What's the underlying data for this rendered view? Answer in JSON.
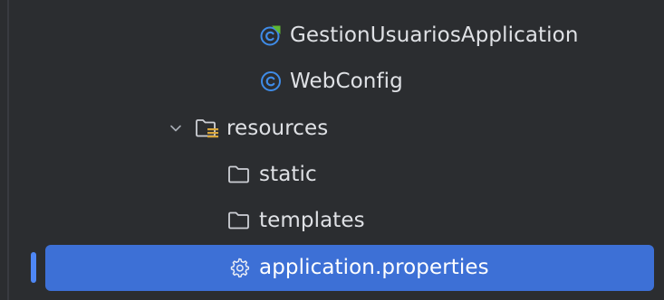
{
  "project_tree": {
    "items": [
      {
        "label": "GestionUsuariosApplication",
        "icon": "spring-boot-class-icon"
      },
      {
        "label": "WebConfig",
        "icon": "class-icon"
      },
      {
        "label": "resources",
        "icon": "resources-folder-icon",
        "expanded": true
      },
      {
        "label": "static",
        "icon": "folder-icon"
      },
      {
        "label": "templates",
        "icon": "folder-icon"
      },
      {
        "label": "application.properties",
        "icon": "settings-file-icon",
        "selected": true
      }
    ]
  },
  "colors": {
    "background": "#2b2d30",
    "selection": "#3d70d6",
    "text": "#dfe1e5",
    "class_icon": "#3f8ce8",
    "spring_green": "#5fb832"
  }
}
